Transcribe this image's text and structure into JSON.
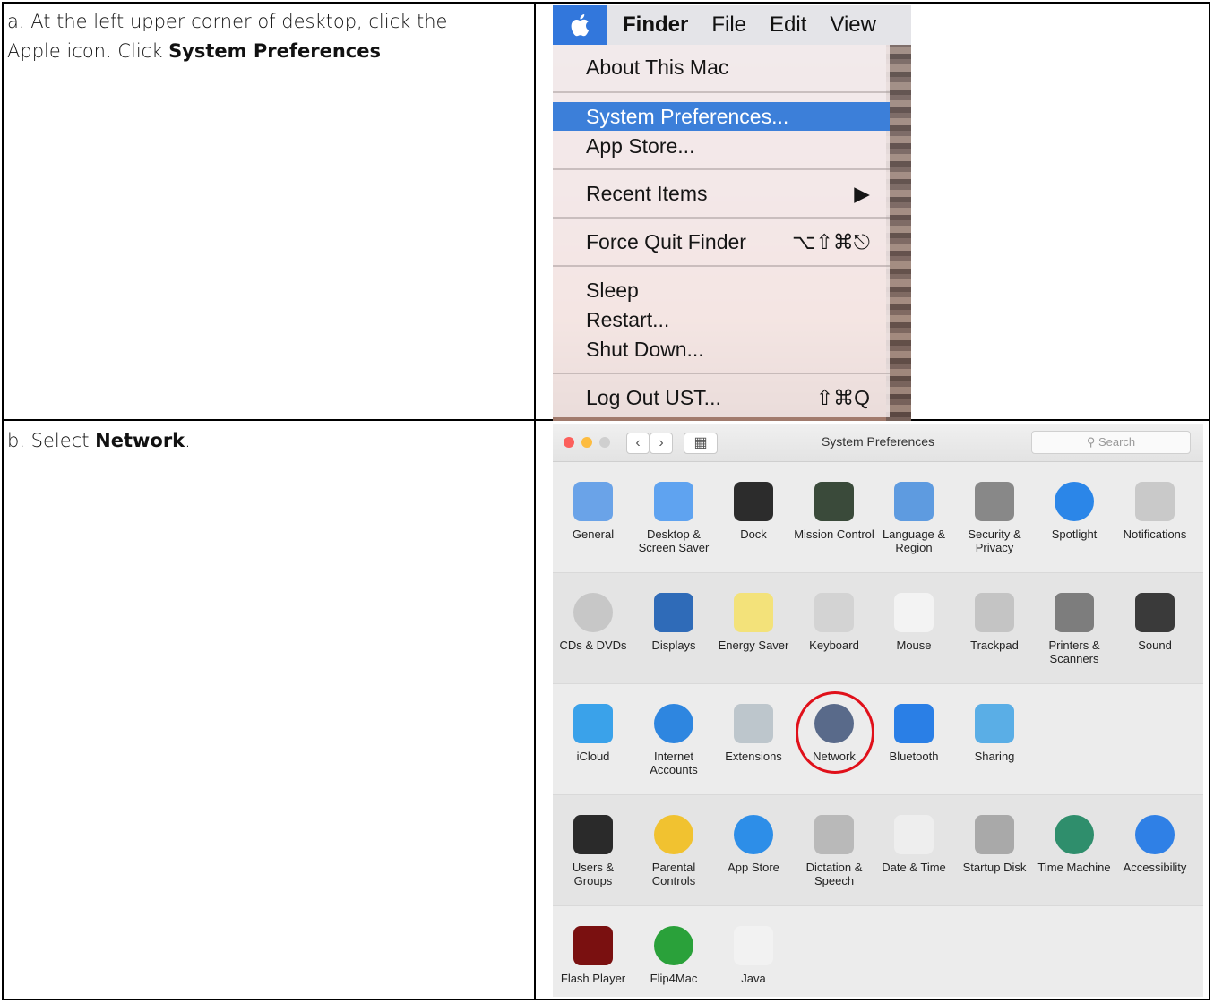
{
  "stepA": {
    "line1": "a. At the left upper corner of desktop, click the",
    "line2_prefix": "Apple icon.  Click ",
    "line2_bold": "System Preferences"
  },
  "stepB": {
    "prefix": "b. Select ",
    "bold": "Network",
    "suffix": "."
  },
  "menubar": {
    "apple_icon": "apple-logo",
    "app": "Finder",
    "items": [
      "File",
      "Edit",
      "View"
    ]
  },
  "apple_menu": {
    "items": [
      {
        "label": "About This Mac",
        "shortcut": ""
      },
      {
        "label": "System Preferences...",
        "shortcut": "",
        "selected": true
      },
      {
        "label": "App Store...",
        "shortcut": ""
      },
      {
        "label": "Recent Items",
        "shortcut": "▶"
      },
      {
        "label": "Force Quit Finder",
        "shortcut": "⌥⇧⌘⎋"
      },
      {
        "label": "Sleep",
        "shortcut": ""
      },
      {
        "label": "Restart...",
        "shortcut": ""
      },
      {
        "label": "Shut Down...",
        "shortcut": ""
      },
      {
        "label": "Log Out UST...",
        "shortcut": "⇧⌘Q"
      }
    ]
  },
  "sysprefs": {
    "title": "System Preferences",
    "search_placeholder": "Search",
    "rows": [
      [
        {
          "label": "General",
          "icon": "general-icon",
          "color": "#6aa3e8"
        },
        {
          "label": "Desktop & Screen Saver",
          "icon": "desktop-icon",
          "color": "#5fa3f0"
        },
        {
          "label": "Dock",
          "icon": "dock-icon",
          "color": "#2c2c2c"
        },
        {
          "label": "Mission Control",
          "icon": "mission-control-icon",
          "color": "#3a4a3a"
        },
        {
          "label": "Language & Region",
          "icon": "language-icon",
          "color": "#5e9be0"
        },
        {
          "label": "Security & Privacy",
          "icon": "security-icon",
          "color": "#888888"
        },
        {
          "label": "Spotlight",
          "icon": "spotlight-icon",
          "color": "#2b86e8"
        },
        {
          "label": "Notifications",
          "icon": "notifications-icon",
          "color": "#c9c9c9"
        }
      ],
      [
        {
          "label": "CDs & DVDs",
          "icon": "cd-icon",
          "color": "#c7c7c7"
        },
        {
          "label": "Displays",
          "icon": "displays-icon",
          "color": "#2f6bb8"
        },
        {
          "label": "Energy Saver",
          "icon": "energy-icon",
          "color": "#f3e27a"
        },
        {
          "label": "Keyboard",
          "icon": "keyboard-icon",
          "color": "#d3d3d3"
        },
        {
          "label": "Mouse",
          "icon": "mouse-icon",
          "color": "#f3f3f3"
        },
        {
          "label": "Trackpad",
          "icon": "trackpad-icon",
          "color": "#c4c4c4"
        },
        {
          "label": "Printers & Scanners",
          "icon": "printer-icon",
          "color": "#7d7d7d"
        },
        {
          "label": "Sound",
          "icon": "sound-icon",
          "color": "#3a3a3a"
        }
      ],
      [
        {
          "label": "iCloud",
          "icon": "icloud-icon",
          "color": "#3aa2ea"
        },
        {
          "label": "Internet Accounts",
          "icon": "internet-accounts-icon",
          "color": "#2e86e0"
        },
        {
          "label": "Extensions",
          "icon": "extensions-icon",
          "color": "#bdc6cc"
        },
        {
          "label": "Network",
          "icon": "network-icon",
          "color": "#596a8a"
        },
        {
          "label": "Bluetooth",
          "icon": "bluetooth-icon",
          "color": "#2a7fe6"
        },
        {
          "label": "Sharing",
          "icon": "sharing-icon",
          "color": "#5aaee6"
        }
      ],
      [
        {
          "label": "Users & Groups",
          "icon": "users-icon",
          "color": "#2a2a2a"
        },
        {
          "label": "Parental Controls",
          "icon": "parental-icon",
          "color": "#f1c230"
        },
        {
          "label": "App Store",
          "icon": "app-store-icon",
          "color": "#2d8ee8"
        },
        {
          "label": "Dictation & Speech",
          "icon": "dictation-icon",
          "color": "#b9b9b9"
        },
        {
          "label": "Date & Time",
          "icon": "date-time-icon",
          "color": "#eeeeee"
        },
        {
          "label": "Startup Disk",
          "icon": "startup-disk-icon",
          "color": "#a9a9a9"
        },
        {
          "label": "Time Machine",
          "icon": "time-machine-icon",
          "color": "#2f8e6c"
        },
        {
          "label": "Accessibility",
          "icon": "accessibility-icon",
          "color": "#2f80e6"
        }
      ],
      [
        {
          "label": "Flash Player",
          "icon": "flash-icon",
          "color": "#7a1010"
        },
        {
          "label": "Flip4Mac",
          "icon": "flip4mac-icon",
          "color": "#2aa13a"
        },
        {
          "label": "Java",
          "icon": "java-icon",
          "color": "#f2f2f2"
        }
      ]
    ]
  }
}
